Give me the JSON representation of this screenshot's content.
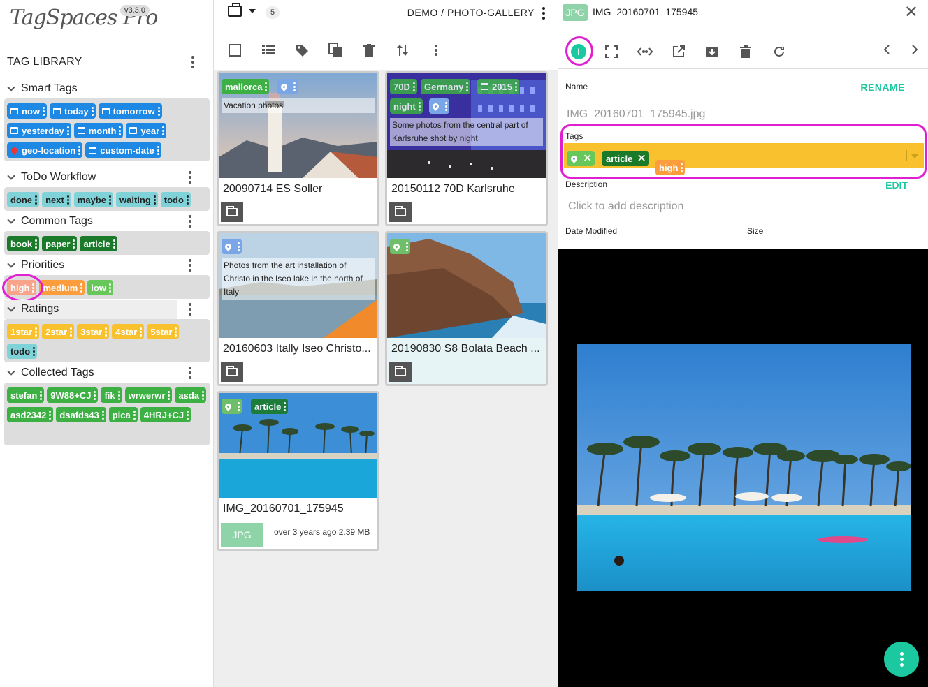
{
  "app": {
    "logo": "TagSpaces Pro",
    "version": "v3.3.0"
  },
  "tag_library": {
    "title": "TAG LIBRARY",
    "groups": [
      {
        "title": "Smart Tags",
        "tags": [
          "now",
          "today",
          "tomorrow",
          "yesterday",
          "month",
          "year",
          "geo-location",
          "custom-date"
        ]
      },
      {
        "title": "ToDo Workflow",
        "tags": [
          "done",
          "next",
          "maybe",
          "waiting",
          "todo"
        ]
      },
      {
        "title": "Common Tags",
        "tags": [
          "book",
          "paper",
          "article"
        ]
      },
      {
        "title": "Priorities",
        "tags": [
          "high",
          "medium",
          "low"
        ]
      },
      {
        "title": "Ratings",
        "tags": [
          "1star",
          "2star",
          "3star",
          "4star",
          "5star",
          "todo"
        ]
      },
      {
        "title": "Collected Tags",
        "tags": [
          "stefan",
          "9W88+CJ",
          "fik",
          "wrwerwr",
          "asda",
          "asd2342",
          "dsafds43",
          "pica",
          "4HRJ+CJ"
        ]
      }
    ]
  },
  "file_list": {
    "count": "5",
    "breadcrumb": "DEMO /  PHOTO-GALLERY",
    "cards": [
      {
        "title": "20090714 ES Soller",
        "tags": [
          "mallorca"
        ],
        "description": "Vacation photos"
      },
      {
        "title": "20150112 70D Karlsruhe",
        "tags": [
          "70D",
          "Germany",
          "2015",
          "night"
        ],
        "description": "Some photos from the central part of Karlsruhe shot by night"
      },
      {
        "title": "20160603 Itally Iseo Christo...",
        "tags": [],
        "description": "Photos from the art installation of Christo in the Iseo lake in the north of Italy"
      },
      {
        "title": "20190830 S8 Bolata Beach ...",
        "tags": [],
        "description": ""
      },
      {
        "title": "IMG_20160701_175945",
        "tags": [
          "article"
        ],
        "description": "",
        "ext": "JPG",
        "meta": "over 3 years ago 2.39 MB"
      }
    ]
  },
  "properties": {
    "ext": "JPG",
    "filename": "IMG_20160701_175945",
    "name_label": "Name",
    "rename_label": "RENAME",
    "name_value": "IMG_20160701_175945.jpg",
    "tags_label": "Tags",
    "tags": [
      "article"
    ],
    "dragged_tag": "high",
    "description_label": "Description",
    "edit_label": "EDIT",
    "description_placeholder": "Click to add description",
    "date_modified_label": "Date Modified",
    "size_label": "Size"
  },
  "colors": {
    "accent": "#1cc8a0",
    "highlight": "#e020d0",
    "tags_field": "#f8c12d"
  }
}
